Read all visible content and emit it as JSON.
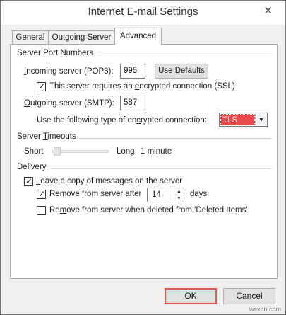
{
  "window": {
    "title": "Internet E-mail Settings",
    "close_glyph": "✕"
  },
  "tabs": [
    {
      "label": "General",
      "active": false
    },
    {
      "label": "Outgoing Server",
      "active": false
    },
    {
      "label": "Advanced",
      "active": true
    }
  ],
  "server_ports": {
    "group_title": "Server Port Numbers",
    "incoming_label_pre": "",
    "incoming_label_u": "I",
    "incoming_label_post": "ncoming server (POP3):",
    "incoming_value": "995",
    "use_defaults_pre": "Use ",
    "use_defaults_u": "D",
    "use_defaults_post": "efaults",
    "ssl_checkbox_pre": "This server requires an ",
    "ssl_checkbox_u": "e",
    "ssl_checkbox_post": "ncrypted connection (SSL)",
    "ssl_checked": true,
    "outgoing_label_pre": "",
    "outgoing_label_u": "O",
    "outgoing_label_post": "utgoing server (SMTP):",
    "outgoing_value": "587",
    "encryption_label_pre": "Use the following type of en",
    "encryption_label_u": "c",
    "encryption_label_post": "rypted connection:",
    "encryption_value": "TLS"
  },
  "server_timeouts": {
    "group_title_pre": "Server ",
    "group_title_u": "T",
    "group_title_post": "imeouts",
    "short_label": "Short",
    "long_label": "Long",
    "timeout_value": "1 minute",
    "slider_level": 0.0
  },
  "delivery": {
    "group_title": "Delivery",
    "leave_copy_pre": "",
    "leave_copy_u": "L",
    "leave_copy_post": "eave a copy of messages on the server",
    "leave_copy_checked": true,
    "remove_after_pre": "",
    "remove_after_u": "R",
    "remove_after_post": "emove from server after",
    "remove_after_checked": true,
    "days_value": "14",
    "days_label": "days",
    "remove_deleted_pre": "Re",
    "remove_deleted_u": "m",
    "remove_deleted_post": "ove from server when deleted from 'Deleted Items'",
    "remove_deleted_checked": false
  },
  "footer": {
    "ok_label": "OK",
    "cancel_label": "Cancel"
  },
  "watermark": "wsxdn.com",
  "colors": {
    "selection": "#e8484a",
    "default_button_border": "#e0594d"
  }
}
